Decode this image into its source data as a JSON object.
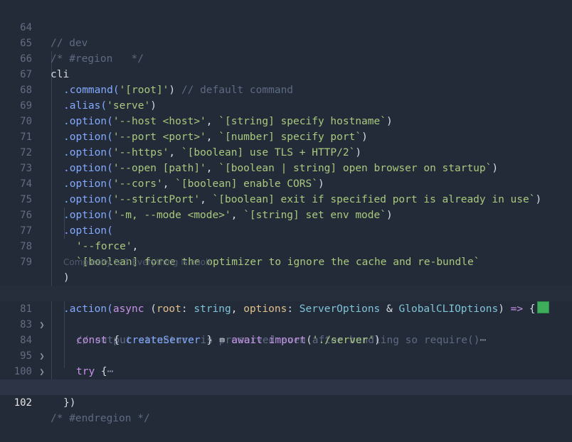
{
  "lines": {
    "l64": {
      "num": "64",
      "text": "// dev"
    },
    "l65": {
      "num": "65",
      "text": "/* #region   */"
    },
    "l66": {
      "num": "66",
      "text": "cli"
    },
    "l67": {
      "num": "67",
      "a": ".command(",
      "b": "'[root]'",
      "c": ") ",
      "d": "// default command"
    },
    "l68": {
      "num": "68",
      "a": ".alias(",
      "b": "'serve'",
      "c": ")"
    },
    "l69": {
      "num": "69",
      "a": ".option(",
      "b": "'--host <host>'",
      "c": ", ",
      "d": "`[string] specify hostname`",
      "e": ")"
    },
    "l70": {
      "num": "70",
      "a": ".option(",
      "b": "'--port <port>'",
      "c": ", ",
      "d": "`[number] specify port`",
      "e": ")"
    },
    "l71": {
      "num": "71",
      "a": ".option(",
      "b": "'--https'",
      "c": ", ",
      "d": "`[boolean] use TLS + HTTP/2`",
      "e": ")"
    },
    "l72": {
      "num": "72",
      "a": ".option(",
      "b": "'--open [path]'",
      "c": ", ",
      "d": "`[boolean | string] open browser on startup`",
      "e": ")"
    },
    "l73": {
      "num": "73",
      "a": ".option(",
      "b": "'--cors'",
      "c": ", ",
      "d": "`[boolean] enable CORS`",
      "e": ")"
    },
    "l74": {
      "num": "74",
      "a": ".option(",
      "b": "'--strictPort'",
      "c": ", ",
      "d": "`[boolean] exit if specified port is already in use`",
      "e": ")"
    },
    "l75": {
      "num": "75",
      "a": ".option(",
      "b": "'-m, --mode <mode>'",
      "c": ", ",
      "d": "`[string] set env mode`",
      "e": ")"
    },
    "l76": {
      "num": "76",
      "a": ".option("
    },
    "l77": {
      "num": "77",
      "a": "'--force'",
      "b": ","
    },
    "l78": {
      "num": "78",
      "a": "`[boolean] force the optimizer to ignore the cache and re-bundle`"
    },
    "l79": {
      "num": "79",
      "a": ")"
    },
    "lens": "Complexity is 3 Everything is cool!",
    "l80": {
      "num": "80",
      "a": ".action(",
      "b": "async",
      "c": " (",
      "d": "root",
      "e": ": ",
      "f": "string",
      "g": ", ",
      "h": "options",
      "i": ": ",
      "j": "ServerOptions",
      "k": " & ",
      "l": "GlobalCLIOptions",
      "m": ") ",
      "n": "=>",
      "o": " {"
    },
    "l81": {
      "num": "81",
      "a": "// output structure is preserved even after bundling so require()",
      "b": "⋯"
    },
    "l83": {
      "num": "83",
      "a": "const",
      "b": " { ",
      "c": "createServer",
      "d": " } = ",
      "e": "await",
      "f": " ",
      "g": "import",
      "h": "(",
      "i": "'./server'",
      "j": ")"
    },
    "l84": {
      "num": "84",
      "a": "try",
      "b": " {",
      "c": "⋯"
    },
    "l95": {
      "num": "95",
      "a": "} ",
      "b": "catch",
      "c": " (",
      "d": "e",
      "e": ") {",
      "f": "⋯"
    },
    "l100": {
      "num": "100",
      "a": "}"
    },
    "l101": {
      "num": "101",
      "a": "})"
    },
    "l102": {
      "num": "102",
      "text": "/* #endregion */"
    }
  },
  "fold_icon": "chevron-right-icon",
  "color_swatch": "#3fae5a"
}
